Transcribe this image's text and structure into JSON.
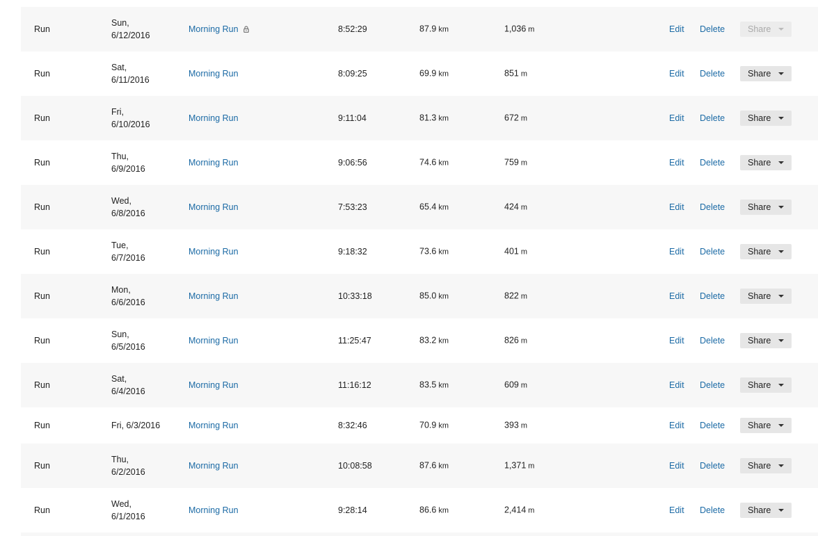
{
  "actions": {
    "edit_label": "Edit",
    "delete_label": "Delete",
    "share_label": "Share"
  },
  "icons": {
    "private": "lock-icon",
    "share_menu": "chevron-down-icon"
  },
  "colors": {
    "link": "#1b6aa5",
    "row_alt": "#f7f7f7",
    "button_bg": "#e6e6e6"
  },
  "activities": [
    {
      "type": "Run",
      "date_line1": "Sun,",
      "date_line2": "6/12/2016",
      "title": "Morning Run",
      "private": true,
      "time": "8:52:29",
      "distance": "87.9",
      "distance_unit": "km",
      "elevation": "1,036",
      "elevation_unit": "m",
      "share_disabled": true
    },
    {
      "type": "Run",
      "date_line1": "Sat,",
      "date_line2": "6/11/2016",
      "title": "Morning Run",
      "private": false,
      "time": "8:09:25",
      "distance": "69.9",
      "distance_unit": "km",
      "elevation": "851",
      "elevation_unit": "m",
      "share_disabled": false
    },
    {
      "type": "Run",
      "date_line1": "Fri,",
      "date_line2": "6/10/2016",
      "title": "Morning Run",
      "private": false,
      "time": "9:11:04",
      "distance": "81.3",
      "distance_unit": "km",
      "elevation": "672",
      "elevation_unit": "m",
      "share_disabled": false
    },
    {
      "type": "Run",
      "date_line1": "Thu,",
      "date_line2": "6/9/2016",
      "title": "Morning Run",
      "private": false,
      "time": "9:06:56",
      "distance": "74.6",
      "distance_unit": "km",
      "elevation": "759",
      "elevation_unit": "m",
      "share_disabled": false
    },
    {
      "type": "Run",
      "date_line1": "Wed,",
      "date_line2": "6/8/2016",
      "title": "Morning Run",
      "private": false,
      "time": "7:53:23",
      "distance": "65.4",
      "distance_unit": "km",
      "elevation": "424",
      "elevation_unit": "m",
      "share_disabled": false
    },
    {
      "type": "Run",
      "date_line1": "Tue,",
      "date_line2": "6/7/2016",
      "title": "Morning Run",
      "private": false,
      "time": "9:18:32",
      "distance": "73.6",
      "distance_unit": "km",
      "elevation": "401",
      "elevation_unit": "m",
      "share_disabled": false
    },
    {
      "type": "Run",
      "date_line1": "Mon,",
      "date_line2": "6/6/2016",
      "title": "Morning Run",
      "private": false,
      "time": "10:33:18",
      "distance": "85.0",
      "distance_unit": "km",
      "elevation": "822",
      "elevation_unit": "m",
      "share_disabled": false
    },
    {
      "type": "Run",
      "date_line1": "Sun,",
      "date_line2": "6/5/2016",
      "title": "Morning Run",
      "private": false,
      "time": "11:25:47",
      "distance": "83.2",
      "distance_unit": "km",
      "elevation": "826",
      "elevation_unit": "m",
      "share_disabled": false
    },
    {
      "type": "Run",
      "date_line1": "Sat,",
      "date_line2": "6/4/2016",
      "title": "Morning Run",
      "private": false,
      "time": "11:16:12",
      "distance": "83.5",
      "distance_unit": "km",
      "elevation": "609",
      "elevation_unit": "m",
      "share_disabled": false
    },
    {
      "type": "Run",
      "date_line1": "Fri, 6/3/2016",
      "date_line2": "",
      "title": "Morning Run",
      "private": false,
      "time": "8:32:46",
      "distance": "70.9",
      "distance_unit": "km",
      "elevation": "393",
      "elevation_unit": "m",
      "share_disabled": false
    },
    {
      "type": "Run",
      "date_line1": "Thu,",
      "date_line2": "6/2/2016",
      "title": "Morning Run",
      "private": false,
      "time": "10:08:58",
      "distance": "87.6",
      "distance_unit": "km",
      "elevation": "1,371",
      "elevation_unit": "m",
      "share_disabled": false
    },
    {
      "type": "Run",
      "date_line1": "Wed,",
      "date_line2": "6/1/2016",
      "title": "Morning Run",
      "private": false,
      "time": "9:28:14",
      "distance": "86.6",
      "distance_unit": "km",
      "elevation": "2,414",
      "elevation_unit": "m",
      "share_disabled": false
    }
  ]
}
